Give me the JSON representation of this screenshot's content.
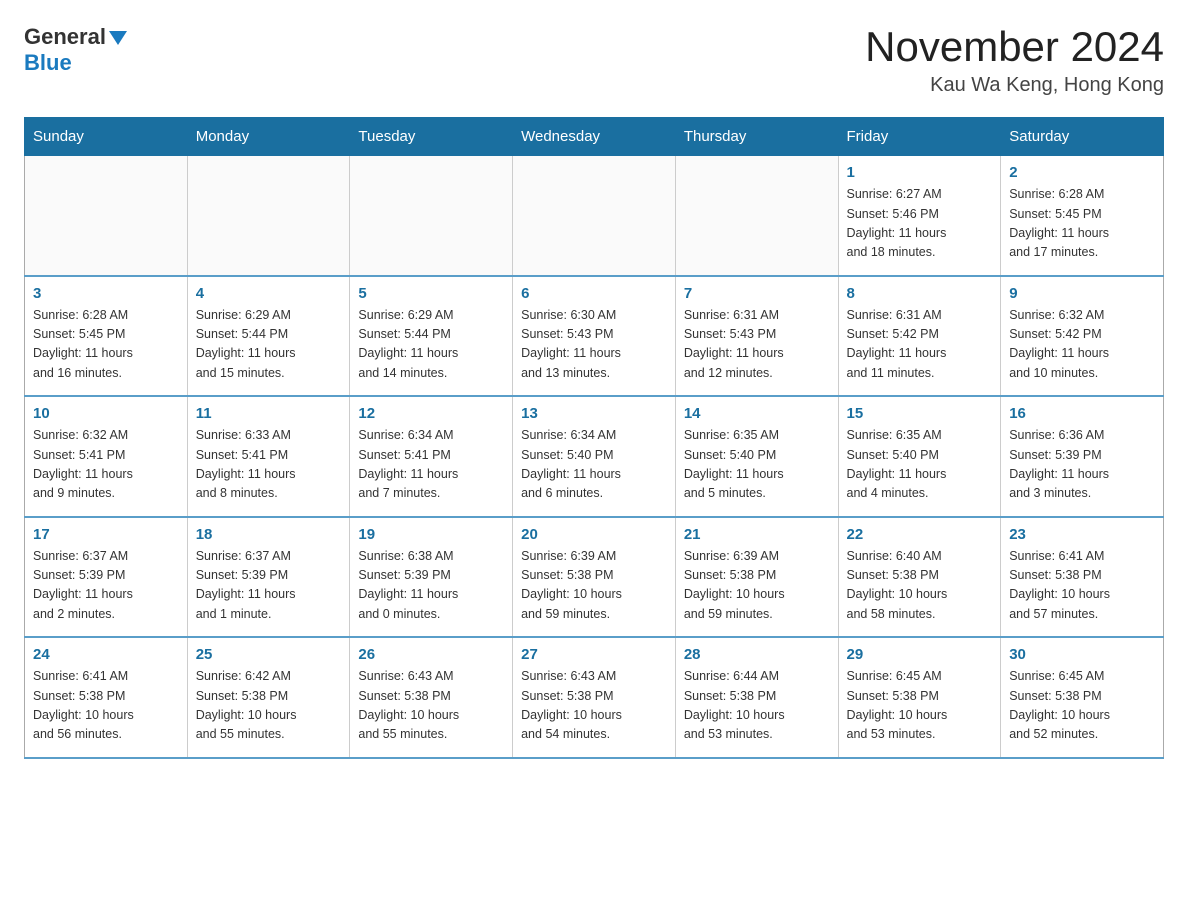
{
  "header": {
    "logo_general": "General",
    "logo_blue": "Blue",
    "month_title": "November 2024",
    "location": "Kau Wa Keng, Hong Kong"
  },
  "days_of_week": [
    "Sunday",
    "Monday",
    "Tuesday",
    "Wednesday",
    "Thursday",
    "Friday",
    "Saturday"
  ],
  "weeks": [
    {
      "days": [
        {
          "number": "",
          "info": ""
        },
        {
          "number": "",
          "info": ""
        },
        {
          "number": "",
          "info": ""
        },
        {
          "number": "",
          "info": ""
        },
        {
          "number": "",
          "info": ""
        },
        {
          "number": "1",
          "info": "Sunrise: 6:27 AM\nSunset: 5:46 PM\nDaylight: 11 hours\nand 18 minutes."
        },
        {
          "number": "2",
          "info": "Sunrise: 6:28 AM\nSunset: 5:45 PM\nDaylight: 11 hours\nand 17 minutes."
        }
      ]
    },
    {
      "days": [
        {
          "number": "3",
          "info": "Sunrise: 6:28 AM\nSunset: 5:45 PM\nDaylight: 11 hours\nand 16 minutes."
        },
        {
          "number": "4",
          "info": "Sunrise: 6:29 AM\nSunset: 5:44 PM\nDaylight: 11 hours\nand 15 minutes."
        },
        {
          "number": "5",
          "info": "Sunrise: 6:29 AM\nSunset: 5:44 PM\nDaylight: 11 hours\nand 14 minutes."
        },
        {
          "number": "6",
          "info": "Sunrise: 6:30 AM\nSunset: 5:43 PM\nDaylight: 11 hours\nand 13 minutes."
        },
        {
          "number": "7",
          "info": "Sunrise: 6:31 AM\nSunset: 5:43 PM\nDaylight: 11 hours\nand 12 minutes."
        },
        {
          "number": "8",
          "info": "Sunrise: 6:31 AM\nSunset: 5:42 PM\nDaylight: 11 hours\nand 11 minutes."
        },
        {
          "number": "9",
          "info": "Sunrise: 6:32 AM\nSunset: 5:42 PM\nDaylight: 11 hours\nand 10 minutes."
        }
      ]
    },
    {
      "days": [
        {
          "number": "10",
          "info": "Sunrise: 6:32 AM\nSunset: 5:41 PM\nDaylight: 11 hours\nand 9 minutes."
        },
        {
          "number": "11",
          "info": "Sunrise: 6:33 AM\nSunset: 5:41 PM\nDaylight: 11 hours\nand 8 minutes."
        },
        {
          "number": "12",
          "info": "Sunrise: 6:34 AM\nSunset: 5:41 PM\nDaylight: 11 hours\nand 7 minutes."
        },
        {
          "number": "13",
          "info": "Sunrise: 6:34 AM\nSunset: 5:40 PM\nDaylight: 11 hours\nand 6 minutes."
        },
        {
          "number": "14",
          "info": "Sunrise: 6:35 AM\nSunset: 5:40 PM\nDaylight: 11 hours\nand 5 minutes."
        },
        {
          "number": "15",
          "info": "Sunrise: 6:35 AM\nSunset: 5:40 PM\nDaylight: 11 hours\nand 4 minutes."
        },
        {
          "number": "16",
          "info": "Sunrise: 6:36 AM\nSunset: 5:39 PM\nDaylight: 11 hours\nand 3 minutes."
        }
      ]
    },
    {
      "days": [
        {
          "number": "17",
          "info": "Sunrise: 6:37 AM\nSunset: 5:39 PM\nDaylight: 11 hours\nand 2 minutes."
        },
        {
          "number": "18",
          "info": "Sunrise: 6:37 AM\nSunset: 5:39 PM\nDaylight: 11 hours\nand 1 minute."
        },
        {
          "number": "19",
          "info": "Sunrise: 6:38 AM\nSunset: 5:39 PM\nDaylight: 11 hours\nand 0 minutes."
        },
        {
          "number": "20",
          "info": "Sunrise: 6:39 AM\nSunset: 5:38 PM\nDaylight: 10 hours\nand 59 minutes."
        },
        {
          "number": "21",
          "info": "Sunrise: 6:39 AM\nSunset: 5:38 PM\nDaylight: 10 hours\nand 59 minutes."
        },
        {
          "number": "22",
          "info": "Sunrise: 6:40 AM\nSunset: 5:38 PM\nDaylight: 10 hours\nand 58 minutes."
        },
        {
          "number": "23",
          "info": "Sunrise: 6:41 AM\nSunset: 5:38 PM\nDaylight: 10 hours\nand 57 minutes."
        }
      ]
    },
    {
      "days": [
        {
          "number": "24",
          "info": "Sunrise: 6:41 AM\nSunset: 5:38 PM\nDaylight: 10 hours\nand 56 minutes."
        },
        {
          "number": "25",
          "info": "Sunrise: 6:42 AM\nSunset: 5:38 PM\nDaylight: 10 hours\nand 55 minutes."
        },
        {
          "number": "26",
          "info": "Sunrise: 6:43 AM\nSunset: 5:38 PM\nDaylight: 10 hours\nand 55 minutes."
        },
        {
          "number": "27",
          "info": "Sunrise: 6:43 AM\nSunset: 5:38 PM\nDaylight: 10 hours\nand 54 minutes."
        },
        {
          "number": "28",
          "info": "Sunrise: 6:44 AM\nSunset: 5:38 PM\nDaylight: 10 hours\nand 53 minutes."
        },
        {
          "number": "29",
          "info": "Sunrise: 6:45 AM\nSunset: 5:38 PM\nDaylight: 10 hours\nand 53 minutes."
        },
        {
          "number": "30",
          "info": "Sunrise: 6:45 AM\nSunset: 5:38 PM\nDaylight: 10 hours\nand 52 minutes."
        }
      ]
    }
  ]
}
